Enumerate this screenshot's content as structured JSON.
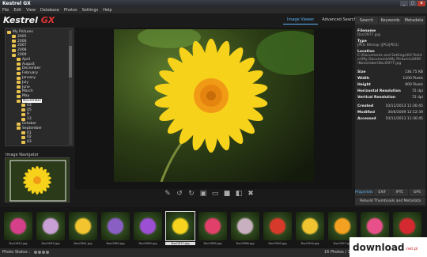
{
  "window": {
    "title": "Kestrel GX",
    "controls": [
      "_",
      "□",
      "x"
    ]
  },
  "menu": [
    "File",
    "Edit",
    "View",
    "Database",
    "Photos",
    "Settings",
    "Help"
  ],
  "logo": {
    "main": "Kestrel",
    "accent": "GX"
  },
  "view_tabs": [
    {
      "label": "Image Viewer",
      "active": true
    },
    {
      "label": "Advanced Search",
      "active": false
    }
  ],
  "tree": [
    {
      "label": "My Pictures",
      "depth": 1
    },
    {
      "label": "2005",
      "depth": 2
    },
    {
      "label": "2006",
      "depth": 2
    },
    {
      "label": "2007",
      "depth": 2
    },
    {
      "label": "2008",
      "depth": 2
    },
    {
      "label": "2009",
      "depth": 2
    },
    {
      "label": "April",
      "depth": 3
    },
    {
      "label": "August",
      "depth": 3
    },
    {
      "label": "December",
      "depth": 3
    },
    {
      "label": "February",
      "depth": 3
    },
    {
      "label": "January",
      "depth": 3
    },
    {
      "label": "July",
      "depth": 3
    },
    {
      "label": "June",
      "depth": 3
    },
    {
      "label": "March",
      "depth": 3
    },
    {
      "label": "May",
      "depth": 3
    },
    {
      "label": "November",
      "depth": 3,
      "selected": true
    },
    {
      "label": "03",
      "depth": 4
    },
    {
      "label": "05",
      "depth": 4
    },
    {
      "label": "9",
      "depth": 4
    },
    {
      "label": "13",
      "depth": 4
    },
    {
      "label": "October",
      "depth": 3
    },
    {
      "label": "September",
      "depth": 3
    },
    {
      "label": "01",
      "depth": 4
    },
    {
      "label": "02",
      "depth": 4
    },
    {
      "label": "03",
      "depth": 4
    }
  ],
  "navigator": {
    "label": "Image Navigator"
  },
  "right_tabs": [
    "Search",
    "Keywords",
    "Metadata"
  ],
  "metadata": {
    "filename_label": "Filename",
    "filename": "DscO977.jpg",
    "type_label": "Type",
    "type": "JPEG Bitmap (JPG/JPEG)",
    "location_label": "Location",
    "location": "C:\\Documents and Settings\\K2 Pointer\\My Documents\\My Pictures\\2009\\November\\DscO977.jpg",
    "size_label": "Size",
    "size": "136.75 KB",
    "width_label": "Width",
    "width": "1200 Pixels",
    "height_label": "Height",
    "height": "900 Pixels",
    "hres_label": "Horizontal Resolution",
    "hres": "72 dpi",
    "vres_label": "Vertical Resolution",
    "vres": "72 dpi",
    "created_label": "Created",
    "created": "10/11/2013 11:30:45",
    "modified_label": "Modified",
    "modified": "30/6/2009 12:12:39",
    "accessed_label": "Accessed",
    "accessed": "10/11/2013 11:30:45"
  },
  "bottom_tabs": [
    {
      "label": "Properties",
      "active": true
    },
    {
      "label": "EXIF",
      "active": false
    },
    {
      "label": "IPTC",
      "active": false
    },
    {
      "label": "GPS",
      "active": false
    }
  ],
  "rebuild_label": "Rebuild Thumbnails and Metadata",
  "toolbar_icons": [
    "pen-icon",
    "rotate-left-icon",
    "rotate-right-icon",
    "monitor-icon",
    "fit-icon",
    "one-to-one-icon",
    "fullscreen-icon",
    "delete-icon"
  ],
  "thumbnails": [
    {
      "caption": "DscO952.jpg",
      "color": "#d5408a"
    },
    {
      "caption": "DscO953.jpg",
      "color": "#c9a0d6"
    },
    {
      "caption": "DscO961.jpg",
      "color": "#f2c530"
    },
    {
      "caption": "DscO965.jpg",
      "color": "#8a5fc4"
    },
    {
      "caption": "DscO969.jpg",
      "color": "#9c4fd3"
    },
    {
      "caption": "DscO977.jpg",
      "color": "#f5d31e",
      "selected": true
    },
    {
      "caption": "DscO985.jpg",
      "color": "#e0406a"
    },
    {
      "caption": "DscO986.jpg",
      "color": "#c8b0c0"
    },
    {
      "caption": "DscO990.jpg",
      "color": "#d63a2a"
    },
    {
      "caption": "DscO994.jpg",
      "color": "#f0c430"
    },
    {
      "caption": "DscO997.jpg",
      "color": "#f4a020"
    },
    {
      "caption": "DscO998.jpg",
      "color": "#e8508a"
    },
    {
      "caption": "DscO999.jpg",
      "color": "#d22a30"
    }
  ],
  "status": {
    "label": "Photo Status :",
    "count": "16 Photos / 1 Selected"
  },
  "watermark": {
    "main": "download",
    "suffix": ".net.pl"
  },
  "colors": {
    "accent": "#5ab4f5",
    "flower": "#f7d21a",
    "center": "#f19a16"
  }
}
